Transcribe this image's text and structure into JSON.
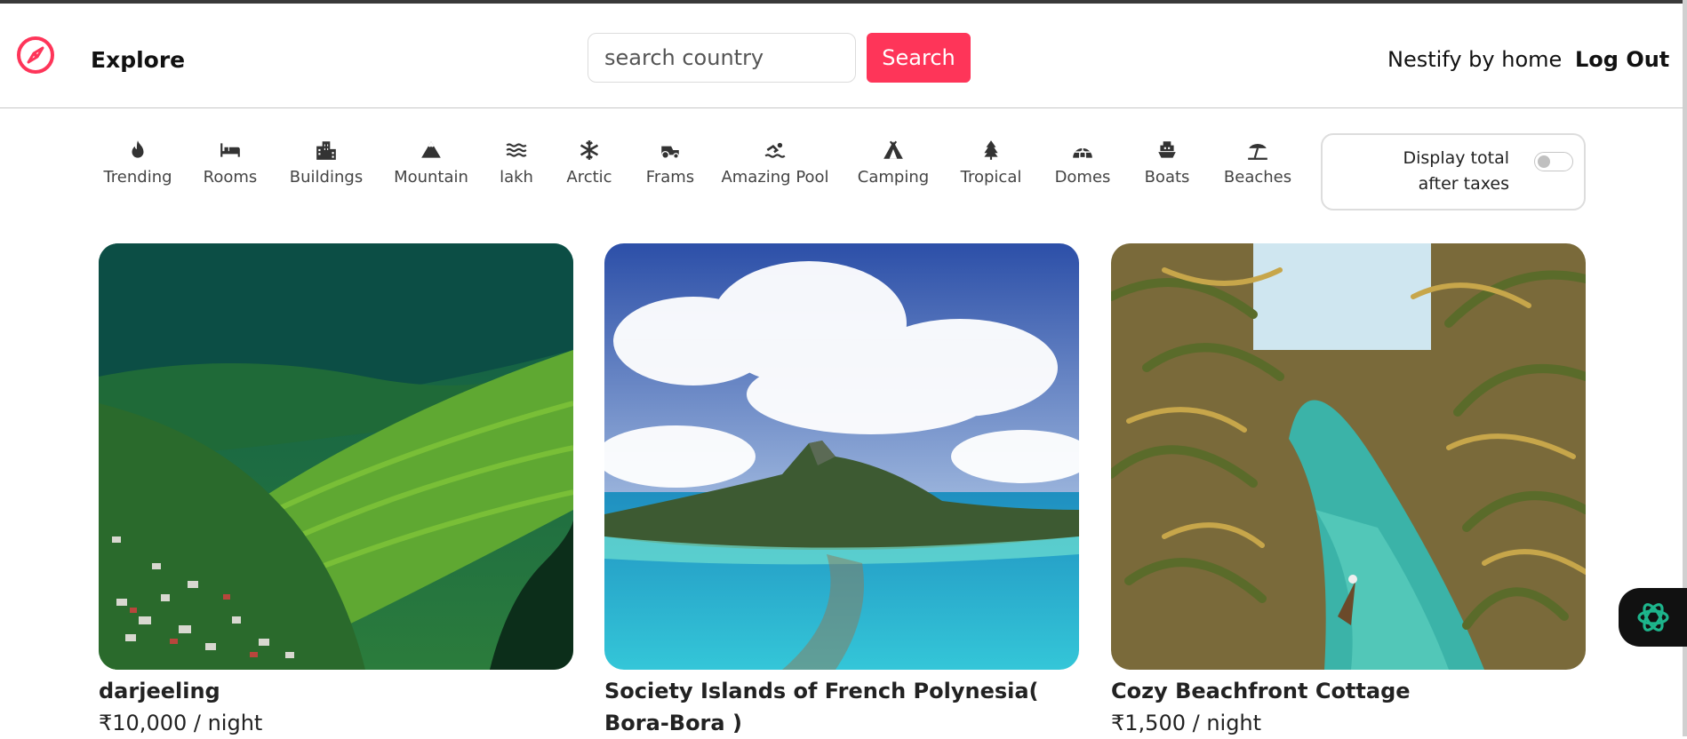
{
  "navbar": {
    "logo_icon": "compass-icon",
    "brand_color": "#fe3559",
    "explore_label": "Explore",
    "search": {
      "placeholder": "search country",
      "value": "",
      "button_label": "Search"
    },
    "host_link": "Nestify by home",
    "logout_link": "Log Out"
  },
  "filters": [
    {
      "label": "Trending",
      "icon": "fire-icon"
    },
    {
      "label": "Rooms",
      "icon": "bed-icon"
    },
    {
      "label": "Buildings",
      "icon": "city-icon"
    },
    {
      "label": "Mountain",
      "icon": "mountain-icon"
    },
    {
      "label": "lakh",
      "icon": "water-icon"
    },
    {
      "label": "Arctic",
      "icon": "snowflake-icon"
    },
    {
      "label": "Frams",
      "icon": "tractor-icon"
    },
    {
      "label": "Amazing Pool",
      "icon": "swimmer-icon"
    },
    {
      "label": "Camping",
      "icon": "tent-icon"
    },
    {
      "label": "Tropical",
      "icon": "tree-icon"
    },
    {
      "label": "Domes",
      "icon": "igloo-icon"
    },
    {
      "label": "Boats",
      "icon": "ship-icon"
    },
    {
      "label": "Beaches",
      "icon": "umbrella-beach-icon"
    }
  ],
  "tax_toggle": {
    "label": "Display total after taxes",
    "enabled": false
  },
  "listings": [
    {
      "title": "darjeeling",
      "price": "₹10,000 / night",
      "image": "tea-garden-hills-photo"
    },
    {
      "title": "Society Islands of French Polynesia( Bora-Bora )",
      "price": "",
      "image": "bora-bora-island-photo"
    },
    {
      "title": "Cozy Beachfront Cottage",
      "price": "₹1,500 / night",
      "image": "palm-lagoon-canoe-photo"
    }
  ],
  "ai_widget": {
    "icon": "openai-logo-icon",
    "accent": "#1db58c"
  }
}
